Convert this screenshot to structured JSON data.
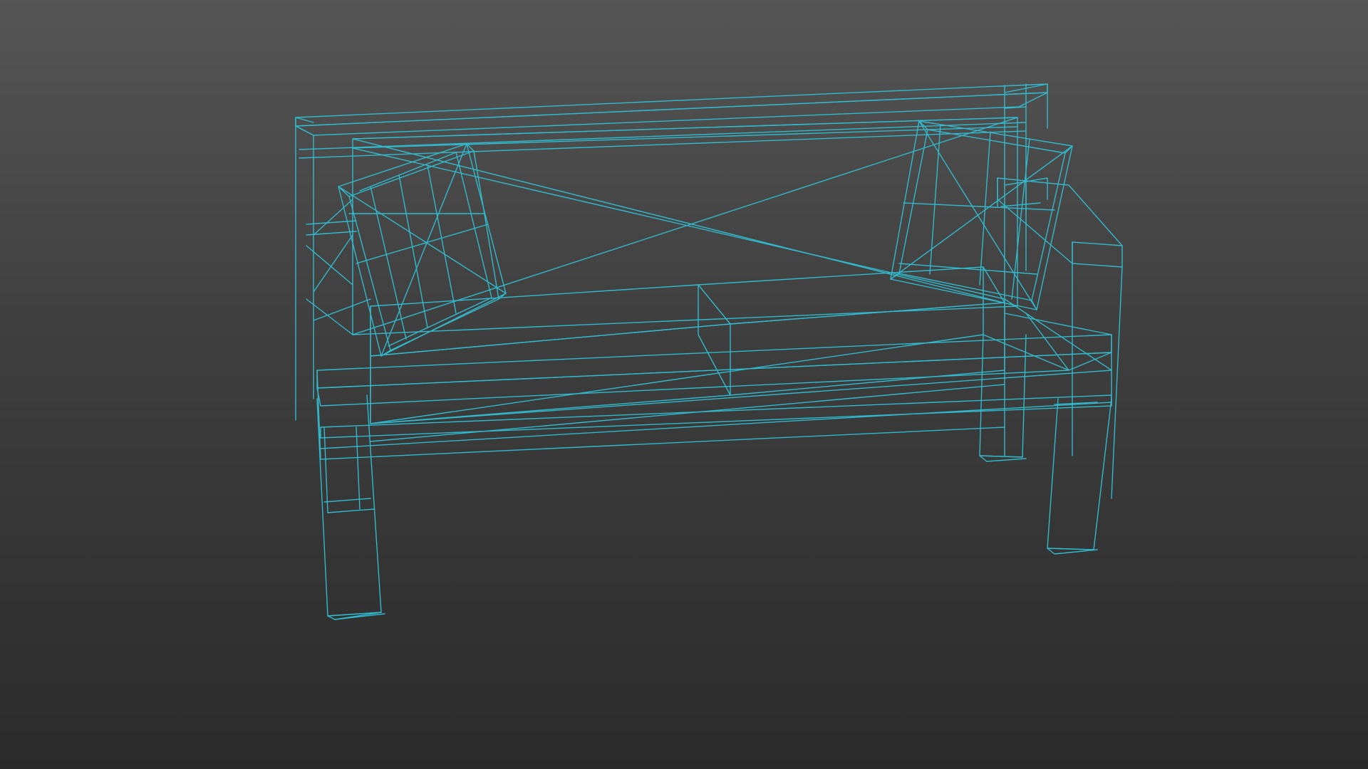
{
  "viewport": {
    "name": "3D viewport",
    "background_top": "#555555",
    "background_bottom": "#2b2b2b"
  },
  "model": {
    "object": "bench",
    "display_mode": "wireframe",
    "wire_color": "#32b9cc",
    "parts": [
      "back-frame",
      "backrest-panel",
      "cushion-left",
      "cushion-right",
      "seat",
      "seat-rails",
      "armrest-right",
      "leg-front-left",
      "leg-front-right",
      "leg-back-right",
      "leg-back-left"
    ]
  }
}
